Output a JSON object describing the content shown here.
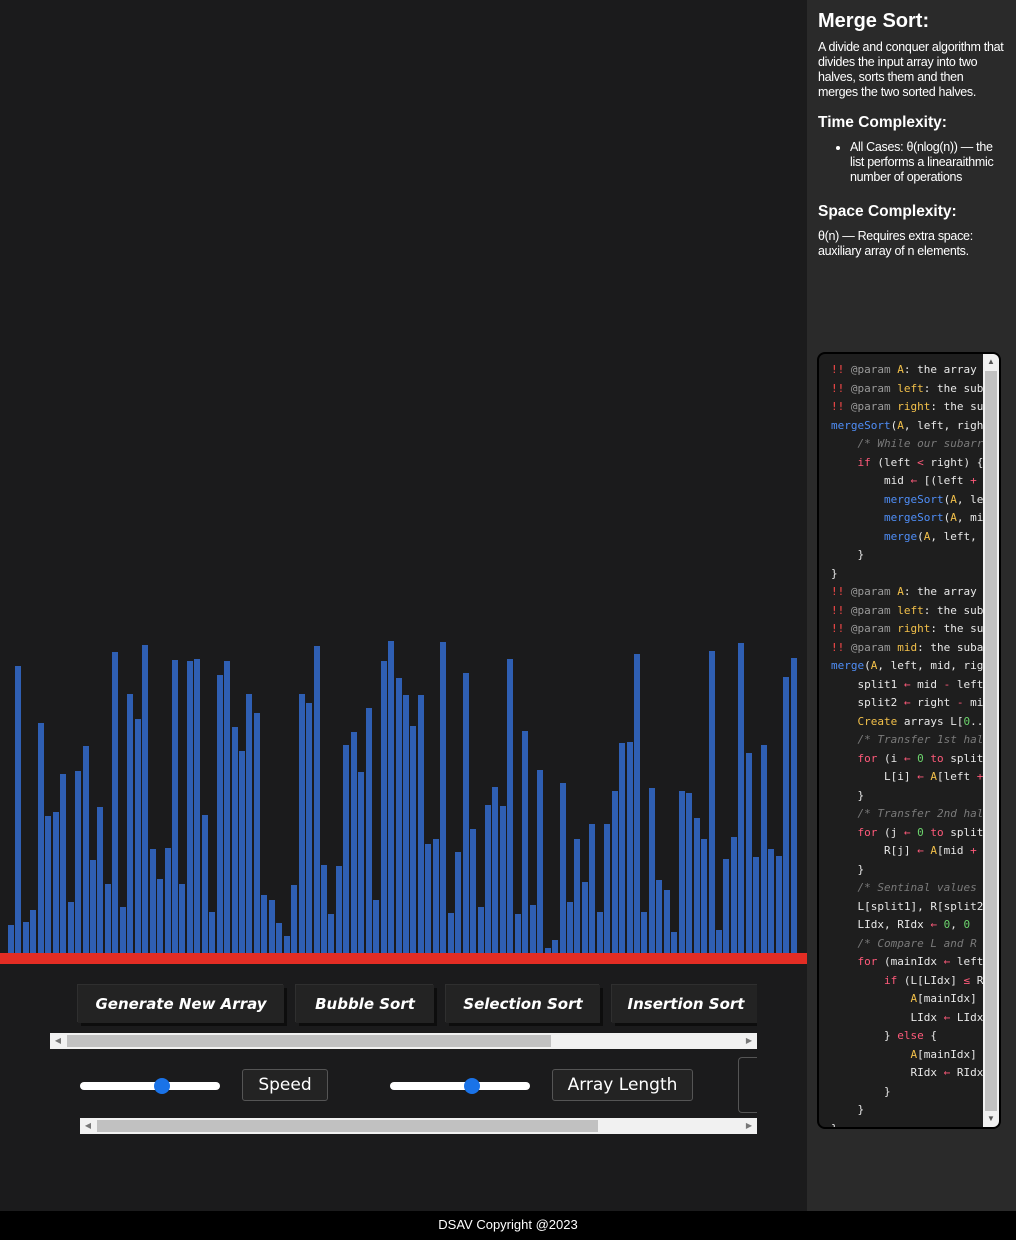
{
  "array_values": [
    23,
    282,
    26,
    38,
    225,
    132,
    136,
    174,
    46,
    177,
    202,
    88,
    141,
    64,
    296,
    41,
    254,
    229,
    303,
    99,
    69,
    100,
    288,
    64,
    287,
    289,
    133,
    36,
    273,
    287,
    221,
    197,
    254,
    235,
    53,
    48,
    25,
    12,
    63,
    254,
    245,
    302,
    83,
    34,
    82,
    203,
    216,
    176,
    240,
    48,
    287,
    307,
    270,
    253,
    222,
    253,
    104,
    109,
    306,
    35,
    96,
    275,
    119,
    41,
    143,
    161,
    142,
    289,
    34,
    217,
    43,
    178,
    0,
    8,
    165,
    46,
    109,
    66,
    124,
    36,
    124,
    157,
    205,
    206,
    294,
    36,
    160,
    68,
    58,
    16,
    157,
    155,
    130,
    109,
    297,
    18,
    89,
    111,
    305,
    195,
    91,
    203,
    99,
    92,
    271,
    290
  ],
  "buttons": {
    "generate": "Generate New Array",
    "bubble": "Bubble Sort",
    "selection": "Selection Sort",
    "insertion": "Insertion Sort"
  },
  "controls": {
    "speed_label": "Speed",
    "speed_value": 0.5,
    "length_label": "Array Length",
    "length_value": 0.5
  },
  "info": {
    "title": "Merge Sort:",
    "description": "A divide and conquer algorithm that divides the input array into two halves, sorts them and then merges the two sorted halves.",
    "time_heading": "Time Complexity:",
    "time_items": [
      "All Cases: θ(nlog(n)) — the list performs a linearaithmic number of operations"
    ],
    "space_heading": "Space Complexity:",
    "space_text": "θ(n) — Requires extra space: auxiliary array of n elements."
  },
  "footer": "DSAV Copyright @2023",
  "colors": {
    "bar": "#2f5fb3",
    "baseline": "#e32d24",
    "background": "#1b1b1c",
    "panel": "#2a2a2a",
    "slider_knob": "#1a73e8"
  }
}
